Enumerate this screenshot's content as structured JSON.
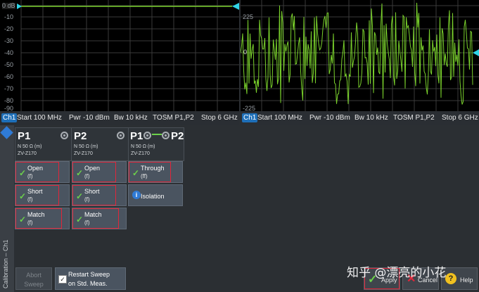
{
  "left_plot": {
    "ref_label": "0 dB",
    "y_ticks": [
      "-10",
      "-20",
      "-30",
      "-40",
      "-50",
      "-60",
      "-70",
      "-80",
      "-90"
    ],
    "trace_level_db": 0
  },
  "right_plot": {
    "y_ticks": [
      "225",
      "-225"
    ],
    "zero_label": "0"
  },
  "status_left": {
    "channel": "Ch1",
    "start": "Start 100 MHz",
    "pwr": "Pwr -10 dBm",
    "bw": "Bw 10 kHz",
    "mode": "TOSM P1,P2",
    "stop": "Stop 6 GHz"
  },
  "status_right": {
    "channel": "Ch1",
    "start": "Start 100 MHz",
    "pwr": "Pwr -10 dBm",
    "bw": "Bw 10 kHz",
    "mode": "TOSM P1,P2",
    "stop": "Stop 6 GHz"
  },
  "side_label": "Calibration – Ch1",
  "ports": [
    {
      "title": "P1",
      "connector": "N 50 Ω (m)",
      "kit": "ZV-Z170",
      "standards": [
        {
          "name": "Open",
          "gender": "(f)"
        },
        {
          "name": "Short",
          "gender": "(f)"
        },
        {
          "name": "Match",
          "gender": "(f)"
        }
      ]
    },
    {
      "title": "P2",
      "connector": "N 50 Ω (m)",
      "kit": "ZV-Z170",
      "standards": [
        {
          "name": "Open",
          "gender": "(f)"
        },
        {
          "name": "Short",
          "gender": "(f)"
        },
        {
          "name": "Match",
          "gender": "(f)"
        }
      ]
    }
  ],
  "through_port": {
    "title_left": "P1",
    "title_right": "P2",
    "connector": "N 50 Ω (m)",
    "kit": "ZV-Z170",
    "through": {
      "name": "Through",
      "gender": "(ff)"
    },
    "isolation": {
      "name": "Isolation",
      "icon": "i"
    }
  },
  "bottom": {
    "abort_l1": "Abort",
    "abort_l2": "Sweep",
    "restart_l1": "Restart Sweep",
    "restart_l2": "on Std. Meas.",
    "apply": "Apply",
    "cancel": "Cancel",
    "help": "Help"
  },
  "watermark": "知乎 @漂亮的小花",
  "colors": {
    "trace": "#7ad12c",
    "accent_blue": "#1e6fb8",
    "highlight_red": "#e0263a",
    "check_green": "#6cd24a"
  }
}
